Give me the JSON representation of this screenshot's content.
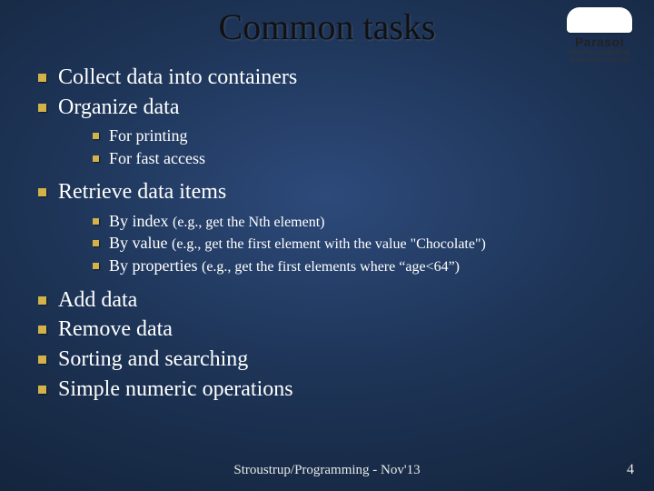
{
  "title": "Common tasks",
  "logo": {
    "name": "Parasol",
    "tagline": "Smarter computing.",
    "university": "Texas A&M University"
  },
  "bullets": [
    {
      "text": "Collect data into containers"
    },
    {
      "text": "Organize data",
      "children": [
        {
          "text": "For printing"
        },
        {
          "text": "For fast access"
        }
      ]
    },
    {
      "text": "Retrieve data items",
      "children": [
        {
          "text": "By index ",
          "paren": "(e.g., get the Nth element)"
        },
        {
          "text": "By value ",
          "paren": "(e.g., get the first element with the value \"Chocolate\")"
        },
        {
          "text": "By properties ",
          "paren": "(e.g., get the first elements where “age<64”)"
        }
      ]
    },
    {
      "text": "Add data"
    },
    {
      "text": "Remove data"
    },
    {
      "text": "Sorting and searching"
    },
    {
      "text": "Simple numeric operations"
    }
  ],
  "footer": "Stroustrup/Programming - Nov'13",
  "page_number": "4"
}
